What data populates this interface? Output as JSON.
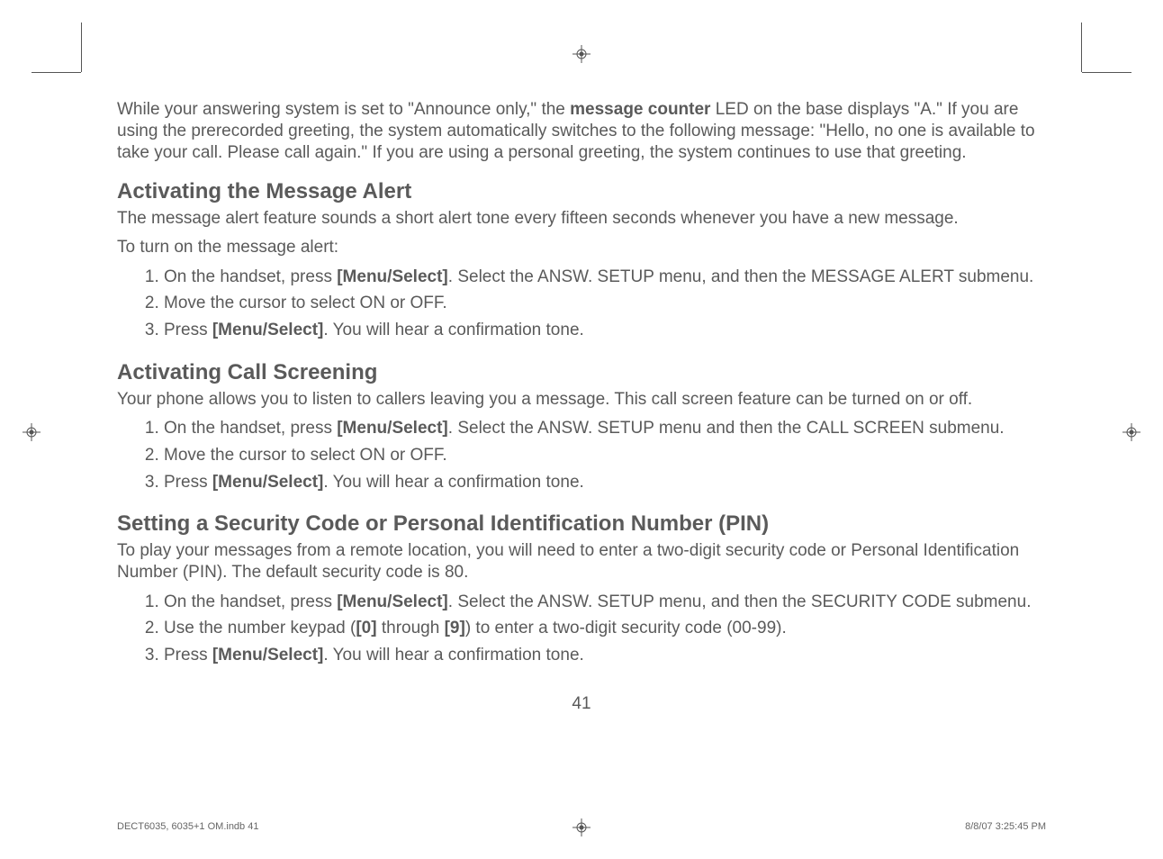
{
  "intro": {
    "part1": "While your answering system is set to \"Announce only,\" the ",
    "bold": "message counter",
    "part2": " LED on the base displays \"A.\" If you are using the prerecorded greeting, the system automatically switches to the following message: \"Hello, no one is available to take your call. Please call again.\" If you are using a personal greeting, the system continues to use that greeting."
  },
  "sections": {
    "alert": {
      "title": "Activating the Message Alert",
      "desc1": "The message alert feature sounds a short alert tone every fifteen seconds whenever you have a new message.",
      "desc2": "To turn on the message alert:",
      "steps": [
        {
          "pre": "On the handset, press ",
          "b1": "[Menu/Select]",
          "post": ". Select the ANSW. SETUP menu, and then the MESSAGE ALERT submenu."
        },
        {
          "pre": "Move the cursor to select ON or OFF.",
          "b1": "",
          "post": ""
        },
        {
          "pre": "Press ",
          "b1": "[Menu/Select]",
          "post": ". You will hear a confirmation tone."
        }
      ]
    },
    "screening": {
      "title": "Activating Call Screening",
      "desc": "Your phone allows you to listen to callers leaving you a message. This call screen feature can be turned on or off.",
      "steps": [
        {
          "pre": "On the handset, press ",
          "b1": "[Menu/Select]",
          "post": ". Select the ANSW. SETUP menu and then the CALL SCREEN submenu."
        },
        {
          "pre": "Move the cursor to select ON or OFF.",
          "b1": "",
          "post": ""
        },
        {
          "pre": "Press ",
          "b1": "[Menu/Select]",
          "post": ". You will hear a confirmation tone."
        }
      ]
    },
    "pin": {
      "title": "Setting a Security Code or Personal Identification Number (PIN)",
      "desc": "To play your messages from a remote location, you will need to enter a two-digit security code or Personal Identification Number (PIN). The default security code is 80.",
      "steps": [
        {
          "pre": "On the handset, press ",
          "b1": "[Menu/Select]",
          "post": ". Select the ANSW. SETUP menu, and then the SECURITY CODE submenu."
        },
        {
          "pre": "Use the number keypad (",
          "b1": "[0]",
          "mid": " through ",
          "b2": "[9]",
          "post": ") to enter a two-digit security code (00-99)."
        },
        {
          "pre": "Press ",
          "b1": "[Menu/Select]",
          "post": ". You will hear a confirmation tone."
        }
      ]
    }
  },
  "pageNumber": "41",
  "footer": {
    "left": "DECT6035, 6035+1 OM.indb   41",
    "right": "8/8/07   3:25:45 PM"
  }
}
